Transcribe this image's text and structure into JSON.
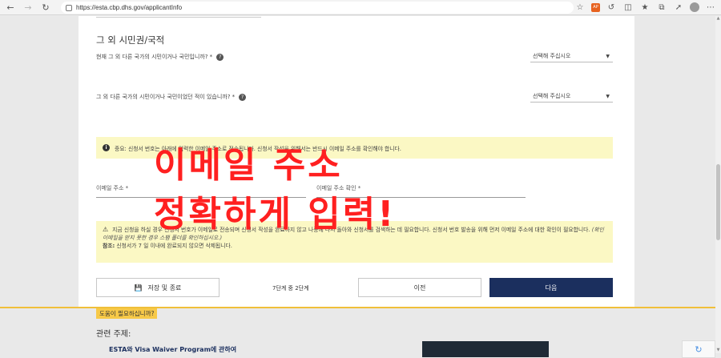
{
  "browser": {
    "url": "https://esta.cbp.dhs.gov/applicantInfo",
    "ext_label": "AP"
  },
  "form": {
    "section_title": "그 외 시민권/국적",
    "q1": "현재 그 외 다른 국가의 시민이거나 국민입니까? *",
    "q2": "그 외 다른 국가의 시민이거나 국민이었던 적이 있습니까? *",
    "select_placeholder": "선택해 주십시오",
    "notice_text": "중요: 신청서 번호는 아래에 입력한 이메일 주소로 전송됩니다. 신청서 작성을 위해서는 반드시 이메일 주소를 확인해야 합니다.",
    "email_label": "이메일 주소 *",
    "email_confirm_label": "이메일 주소 확인 *",
    "warning_line1": "지금 신청을 하실 경우 신청서 번호가 이메일로 전송되며 신청서 작성을 완료하지 않고 나중에 다시 돌아와 신청서를 검색하는 데 필요합니다. 신청서 번호 발송을 위해 먼저 이메일 주소에 대한 확인이 필요합니다.",
    "warning_italic": "(확인 이메일을 받지 못한 경우 스팸 폴더를 확인하십시오.)",
    "warning_note_label": "참조:",
    "warning_note": "신청서가 7 일 이내에 완료되지 않으면 삭제됩니다.",
    "save_label": "저장 및 종료",
    "step_text": "7단계 중 2단계",
    "prev_label": "이전",
    "next_label": "다음"
  },
  "footer": {
    "help_tab": "도움이 필요하십니까?",
    "related_title": "관련 주제:",
    "related_link": "ESTA와 Visa Waiver Program에 관하여"
  },
  "overlay": {
    "line1": "이메일 주소",
    "line2": "정확하게 입력!",
    "color": "#ff2020"
  },
  "colors": {
    "primary_button": "#1b2f5e",
    "notice_bg": "#fbf8c4",
    "footer_accent": "#f0bf3a"
  }
}
